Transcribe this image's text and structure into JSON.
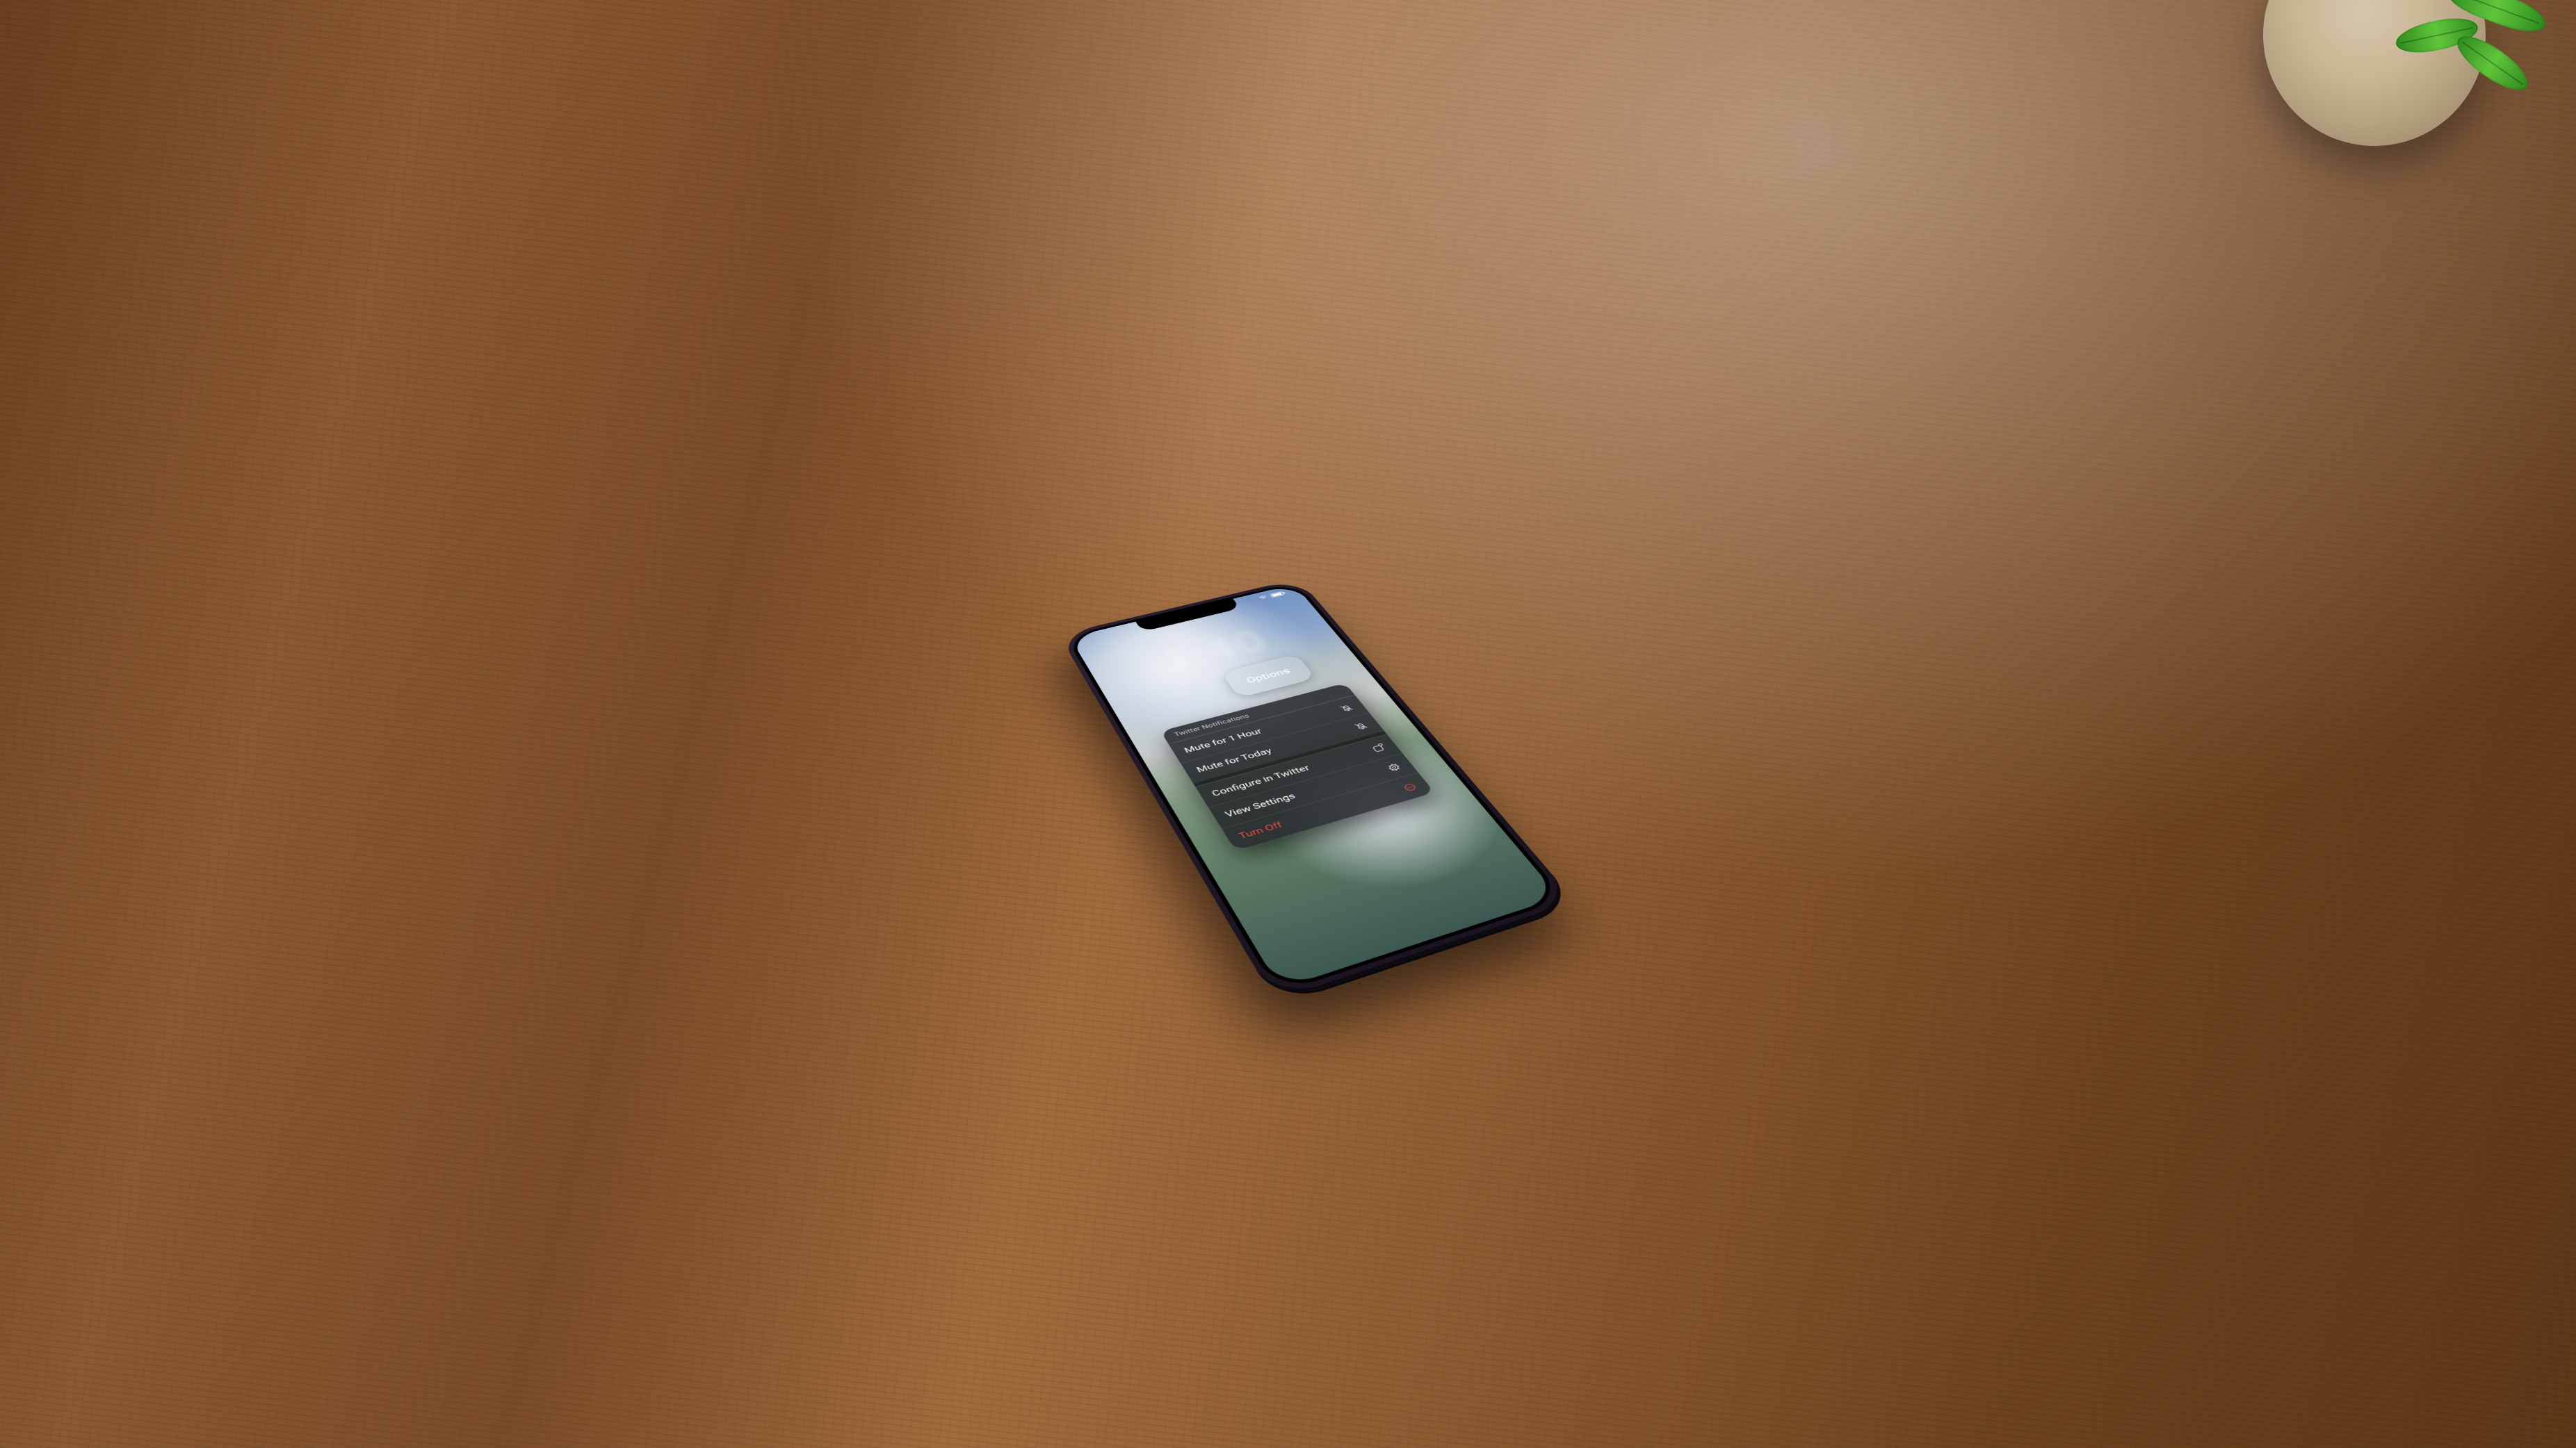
{
  "status_bar": {
    "wifi_icon": "wifi",
    "battery_icon": "battery"
  },
  "lock_screen": {
    "blurred_time": "1:40"
  },
  "options_pill": {
    "label": "Options"
  },
  "menu": {
    "header": "Twitter Notifications",
    "groups": [
      [
        {
          "label": "Mute for 1 Hour",
          "icon": "bell-slash"
        },
        {
          "label": "Mute for Today",
          "icon": "bell-slash"
        }
      ],
      [
        {
          "label": "Configure in Twitter",
          "icon": "app-badge"
        },
        {
          "label": "View Settings",
          "icon": "gear"
        },
        {
          "label": "Turn Off",
          "icon": "circle-minus",
          "destructive": true
        }
      ]
    ]
  }
}
